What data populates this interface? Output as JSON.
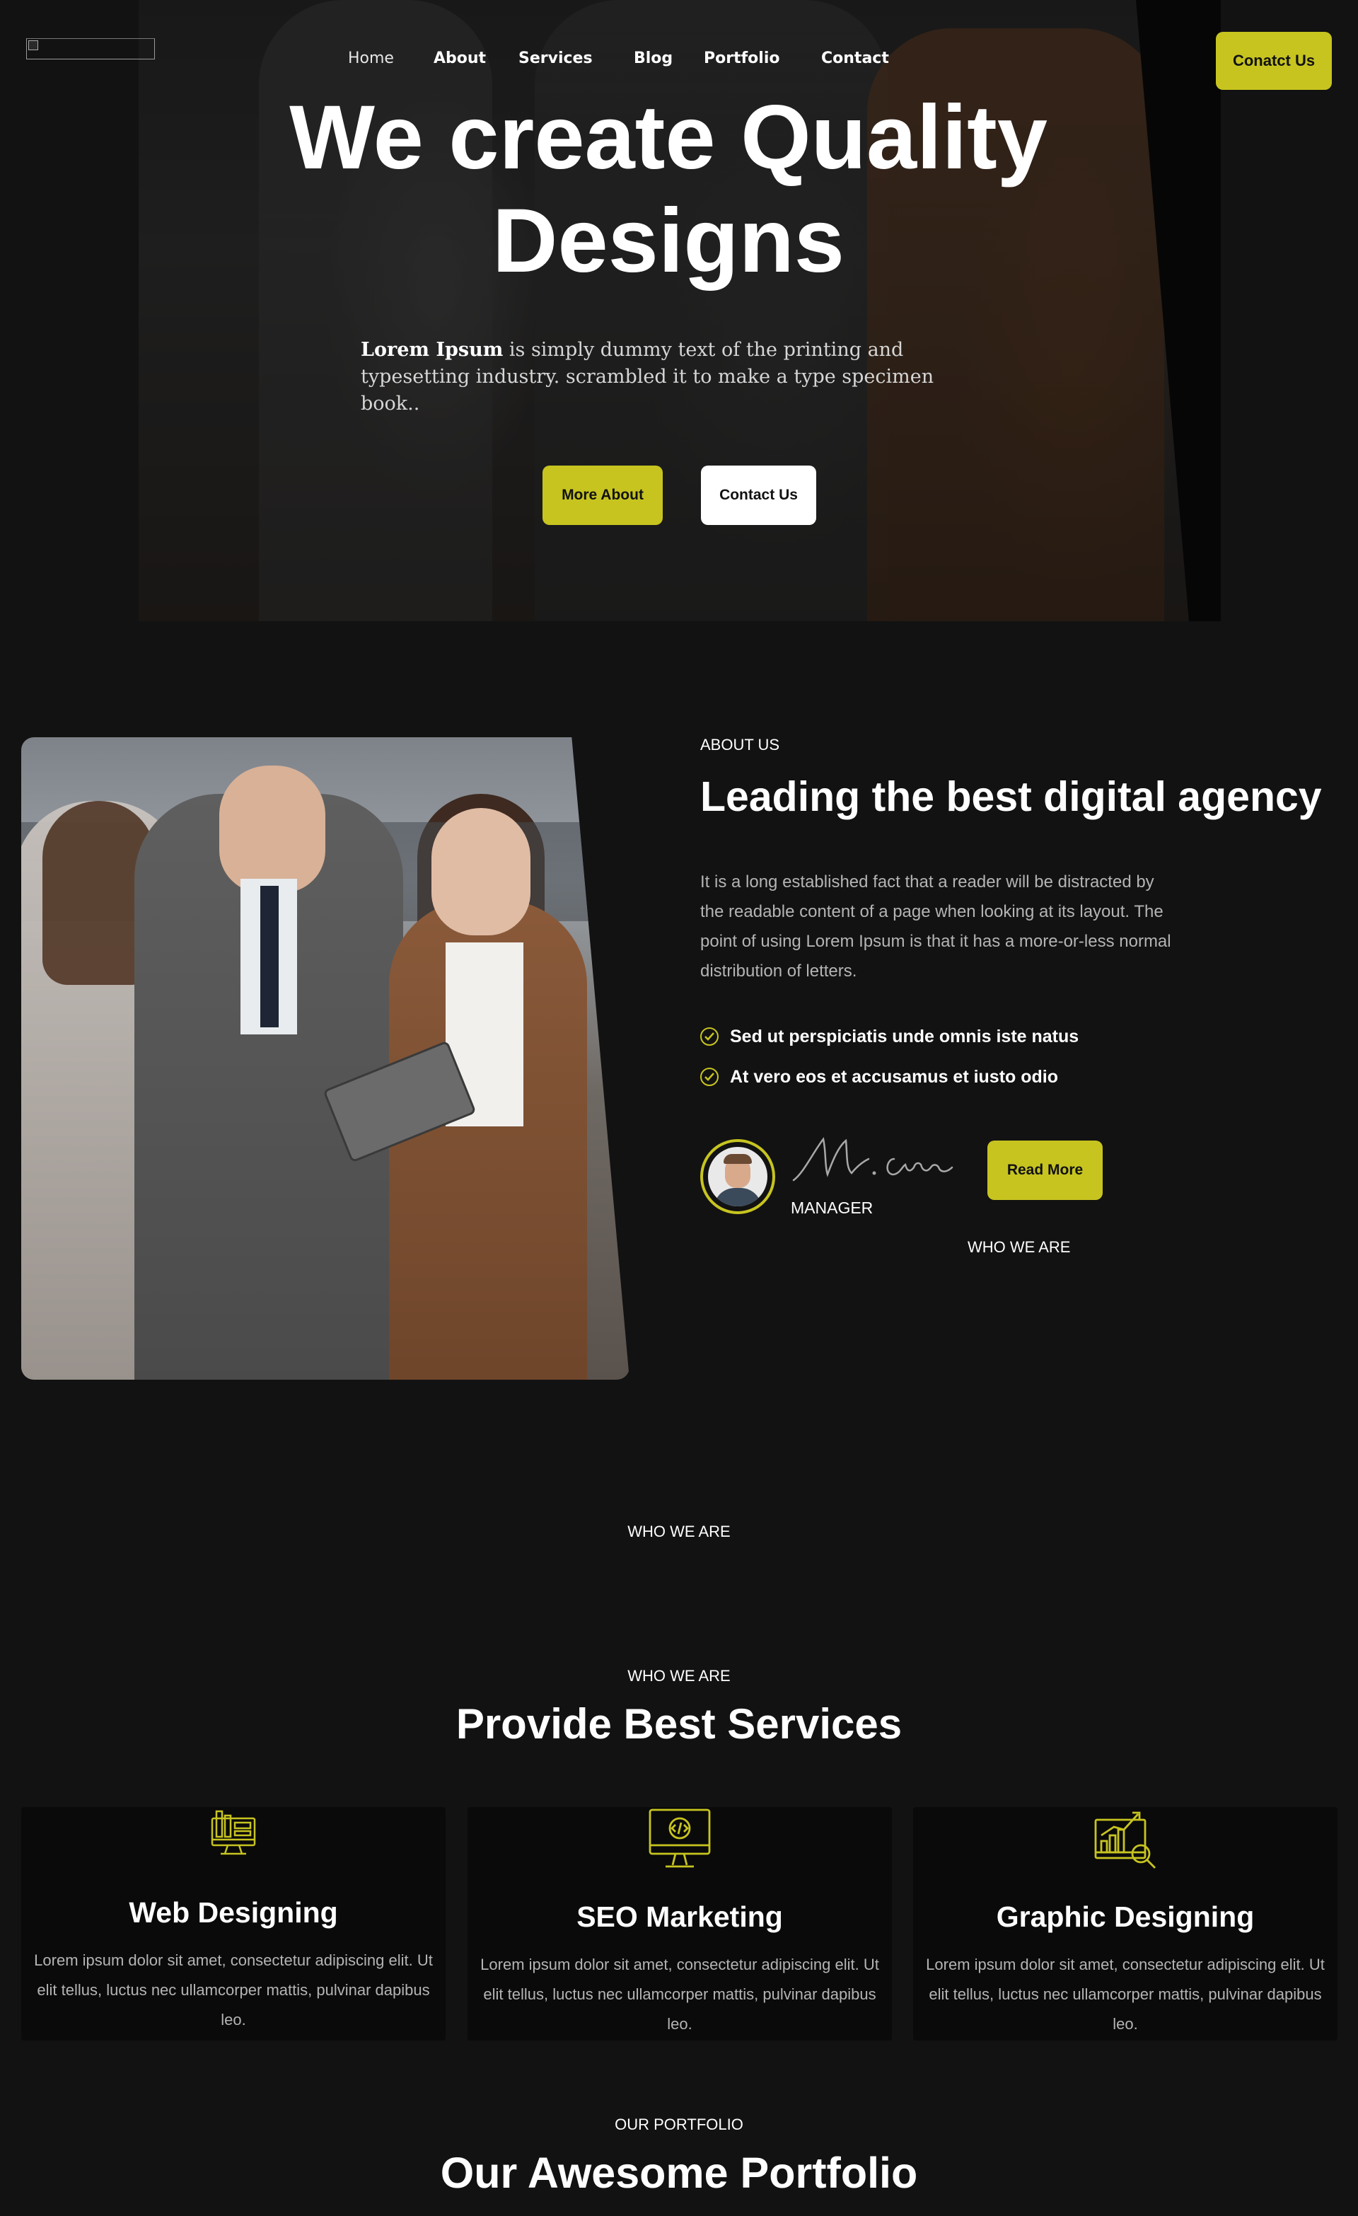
{
  "nav": {
    "items": [
      "Home",
      "About",
      "Services",
      "Blog",
      "Portfolio",
      "Contact"
    ],
    "cta": "Conatct Us"
  },
  "hero": {
    "title_line1": "We create Quality",
    "title_line2": "Designs",
    "desc_bold": "Lorem Ipsum",
    "desc_rest": " is simply dummy text of the printing and typesetting industry.  scrambled it to make a type specimen book..",
    "btn_primary": "More About",
    "btn_secondary": "Contact Us"
  },
  "about": {
    "eyebrow": "ABOUT US",
    "title": "Leading the best digital agency",
    "text": "It is a long established fact that a reader will be distracted by the readable content of a page when looking at its layout. The point of using Lorem Ipsum is that it has a more-or-less normal distribution of letters.",
    "checks": [
      "Sed ut perspiciatis unde omnis iste natus",
      "At vero eos et accusamus et iusto odio"
    ],
    "role": "MANAGER",
    "read_more": "Read More",
    "who_we_are": "WHO WE ARE"
  },
  "who_section": {
    "label": "WHO WE ARE"
  },
  "services": {
    "eyebrow": "WHO WE ARE",
    "title": "Provide Best Services",
    "cards": [
      {
        "icon": "web-design-icon",
        "title": "Web Designing",
        "text": "Lorem ipsum dolor sit amet, consectetur adipiscing elit. Ut elit tellus, luctus nec ullamcorper mattis, pulvinar dapibus leo."
      },
      {
        "icon": "seo-code-icon",
        "title": "SEO Marketing",
        "text": "Lorem ipsum dolor sit amet, consectetur adipiscing elit. Ut elit tellus, luctus nec ullamcorper mattis, pulvinar dapibus leo."
      },
      {
        "icon": "analytics-chart-icon",
        "title": "Graphic Designing",
        "text": "Lorem ipsum dolor sit amet, consectetur adipiscing elit. Ut elit tellus, luctus nec ullamcorper mattis, pulvinar dapibus leo."
      }
    ]
  },
  "portfolio": {
    "eyebrow": "OUR PORTFOLIO",
    "title": "Our Awesome Portfolio"
  },
  "colors": {
    "background": "#121212",
    "accent": "#c7c420",
    "text": "#ffffff",
    "muted": "#b4b4b4",
    "card": "#0a0a0a"
  }
}
